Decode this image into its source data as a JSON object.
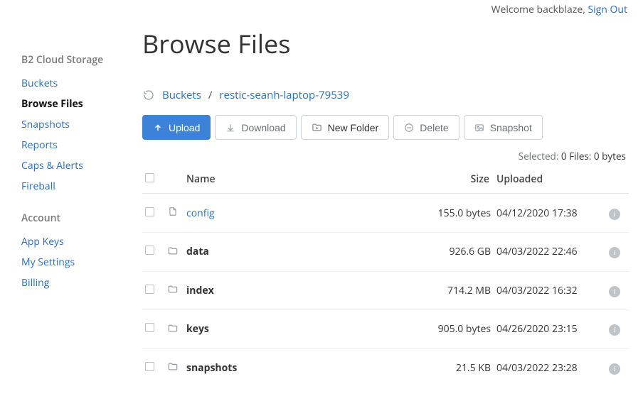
{
  "topbar": {
    "welcome_prefix": "Welcome ",
    "username": "backblaze",
    "comma": ", ",
    "signout": "Sign Out"
  },
  "sidebar": {
    "section1_title": "B2 Cloud Storage",
    "section1_items": [
      {
        "label": "Buckets",
        "active": false
      },
      {
        "label": "Browse Files",
        "active": true
      },
      {
        "label": "Snapshots",
        "active": false
      },
      {
        "label": "Reports",
        "active": false
      },
      {
        "label": "Caps & Alerts",
        "active": false
      },
      {
        "label": "Fireball",
        "active": false
      }
    ],
    "section2_title": "Account",
    "section2_items": [
      {
        "label": "App Keys"
      },
      {
        "label": "My Settings"
      },
      {
        "label": "Billing"
      }
    ]
  },
  "page": {
    "title": "Browse Files"
  },
  "breadcrumb": {
    "root": "Buckets",
    "sep": "/",
    "bucket": "restic-seanh-laptop-79539"
  },
  "toolbar": {
    "upload": "Upload",
    "download": "Download",
    "newfolder": "New Folder",
    "delete": "Delete",
    "snapshot": "Snapshot"
  },
  "selected": {
    "label": "Selected: ",
    "value": "0 Files: 0 bytes"
  },
  "table": {
    "headers": {
      "name": "Name",
      "size": "Size",
      "uploaded": "Uploaded"
    },
    "rows": [
      {
        "type": "file",
        "name": "config",
        "size": "155.0 bytes",
        "uploaded": "04/12/2020 17:38"
      },
      {
        "type": "folder",
        "name": "data",
        "size": "926.6 GB",
        "uploaded": "04/03/2022 22:46"
      },
      {
        "type": "folder",
        "name": "index",
        "size": "714.2 MB",
        "uploaded": "04/03/2022 16:32"
      },
      {
        "type": "folder",
        "name": "keys",
        "size": "905.0 bytes",
        "uploaded": "04/26/2020 23:15"
      },
      {
        "type": "folder",
        "name": "snapshots",
        "size": "21.5 KB",
        "uploaded": "04/03/2022 23:28"
      }
    ]
  },
  "icons": {
    "info_glyph": "i"
  }
}
